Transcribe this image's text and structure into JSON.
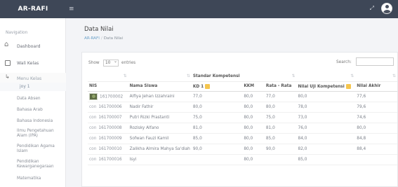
{
  "app": {
    "brand": "AR-RAFI",
    "menu_icon": "≡",
    "expand_icon": "⤢"
  },
  "sidebar": {
    "nav_label": "Navigation",
    "items": [
      {
        "label": "Dashboard",
        "icon": "home-icon"
      },
      {
        "label": "Wali Kelas",
        "icon": "box-icon"
      },
      {
        "label": "Menu Kelas",
        "icon": "arrow-icon"
      }
    ],
    "submenu_active": "joy 1",
    "subjects": [
      "Data Absen",
      "Bahasa Arab",
      "Bahasa Indonesia",
      "Ilmu Pengetahuan Alam (IPA)",
      "Pendidikan Agama Islam",
      "Pendidikan Kewarganegaraan",
      "Matematika"
    ]
  },
  "page": {
    "title": "Data Nilai",
    "breadcrumb": [
      "AR-RAFI",
      "Data Nilai"
    ]
  },
  "table_controls": {
    "show_label": "Show",
    "entries_value": "10",
    "entries_label": "entries",
    "search_label": "Search:"
  },
  "table": {
    "group_header": "Standar Kompetensi",
    "headers": [
      "NIS",
      "Nama Siswa",
      "KD 1",
      "KKM",
      "Rata - Rata",
      "Nilai Uji Kompetensi",
      "Nilai Akhir"
    ],
    "rows": [
      {
        "nis": "161700002",
        "photo": true,
        "name": "Alfiya Jehan Izzahraini",
        "kd1": "77,0",
        "kkm": "80,0",
        "avg": "77,0",
        "uji": "80,0",
        "akhir": "77,6"
      },
      {
        "nis": "161700006",
        "photo": false,
        "name": "Nadir Fathir",
        "kd1": "80,0",
        "kkm": "80,0",
        "avg": "80,0",
        "uji": "78,0",
        "akhir": "79,6"
      },
      {
        "nis": "161700007",
        "photo": false,
        "name": "Putri Rizki Prastanti",
        "kd1": "75,0",
        "kkm": "80,0",
        "avg": "75,0",
        "uji": "73,0",
        "akhir": "74,6"
      },
      {
        "nis": "161700008",
        "photo": false,
        "name": "Rozisky Alfano",
        "kd1": "81,0",
        "kkm": "80,0",
        "avg": "81,0",
        "uji": "76,0",
        "akhir": "80,0"
      },
      {
        "nis": "161700009",
        "photo": false,
        "name": "Sofwan Fauzi Kamil",
        "kd1": "85,0",
        "kkm": "80,0",
        "avg": "85,0",
        "uji": "84,0",
        "akhir": "84,8"
      },
      {
        "nis": "161700010",
        "photo": false,
        "name": "Zalikha Almira Mahya Sa'diah",
        "kd1": "90,0",
        "kkm": "80,0",
        "avg": "90,0",
        "uji": "82,0",
        "akhir": "88,4"
      },
      {
        "nis": "161700016",
        "photo": false,
        "name": "Isyi",
        "kd1": "",
        "kkm": "80,0",
        "avg": "",
        "uji": "85,0",
        "akhir": ""
      }
    ],
    "noimg_label": "con"
  }
}
